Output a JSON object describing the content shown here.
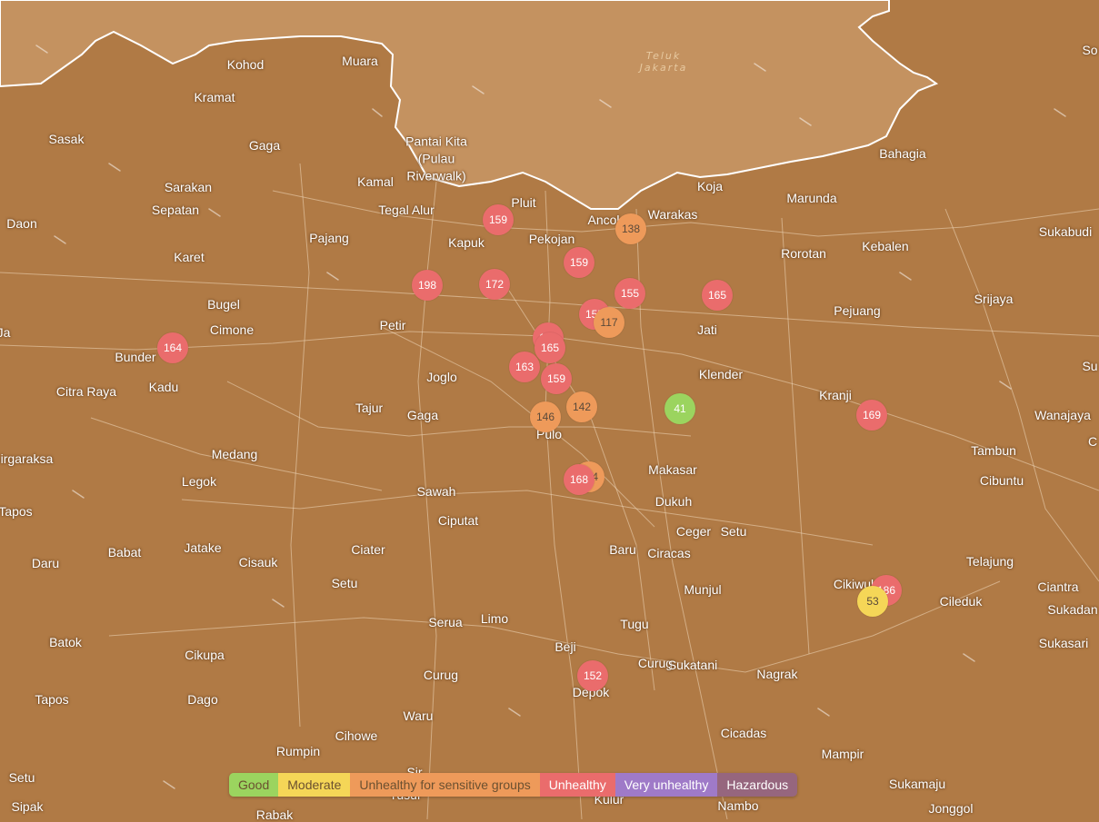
{
  "colors": {
    "land": "#b07a45",
    "water": "#c49260",
    "coast": "#ffffff",
    "good": "#9bd45f",
    "moderate": "#f5d657",
    "sensitive": "#ee9a5a",
    "unhealthy": "#ea6c6c",
    "very_unhealthy": "#9f7ac8",
    "hazardous": "#96667e"
  },
  "water_label": "Teluk\nJakarta",
  "places": [
    "Kohod",
    "Muara",
    "Kramat",
    "Sasak",
    "Gaga",
    "Pantai Kita\n(Pulau\nRiverwalk)",
    "Sarakan",
    "Sepatan",
    "Kamal",
    "Tegal Alur",
    "Pluit",
    "Daon",
    "Pajang",
    "Kapuk",
    "Pekojan",
    "Ancol",
    "Warakas",
    "Koja",
    "Marunda",
    "Bahagia",
    "Sukabudi",
    "Kebalen",
    "Rorotan",
    "Karet",
    "Bugel",
    "Cimone",
    "Petir",
    "Jati",
    "Pejuang",
    "Srijaya",
    "Bunder",
    "Citra Raya",
    "Kadu",
    "Joglo",
    "Klender",
    "Kranji",
    "Tajur",
    "Gaga",
    "Pulo",
    "Wanajaya",
    "Tambun",
    "Cibuntu",
    "Medang",
    "Legok",
    "Sawah",
    "Makasar",
    "Dukuh",
    "Ciputat",
    "Ceger",
    "Setu",
    "Babat",
    "Jatake",
    "Tapos",
    "Daru",
    "Cisauk",
    "Ciater",
    "Baru",
    "Ciracas",
    "Setu",
    "Telajung",
    "Ciantra",
    "Sukadan",
    "Munjul",
    "Cikiwul",
    "Cileduk",
    "Serua",
    "Limo",
    "Tugu",
    "Sukasari",
    "Batok",
    "Cikupa",
    "Beji",
    "Curug",
    "Curug",
    "Sukatani",
    "Nagrak",
    "Tapos",
    "Dago",
    "Depok",
    "Waru",
    "Cihowe",
    "Cicadas",
    "Rumpin",
    "Mampir",
    "Setu",
    "Sukamaju",
    "Sipak",
    "Nambo",
    "Jonggol",
    "Rabak",
    "Sir",
    "Tusur",
    "Kulur",
    "Girgaraksa",
    "Ja",
    "So",
    "Su",
    "C"
  ],
  "stations": [
    {
      "value": "159",
      "level": "unhealthy"
    },
    {
      "value": "138",
      "level": "sensitive"
    },
    {
      "value": "159",
      "level": "unhealthy"
    },
    {
      "value": "198",
      "level": "unhealthy"
    },
    {
      "value": "172",
      "level": "unhealthy"
    },
    {
      "value": "155",
      "level": "unhealthy"
    },
    {
      "value": "165",
      "level": "unhealthy"
    },
    {
      "value": "155",
      "level": "unhealthy"
    },
    {
      "value": "117",
      "level": "sensitive"
    },
    {
      "value": "164",
      "level": "unhealthy"
    },
    {
      "value": "162",
      "level": "unhealthy"
    },
    {
      "value": "165",
      "level": "unhealthy"
    },
    {
      "value": "163",
      "level": "unhealthy"
    },
    {
      "value": "159",
      "level": "unhealthy"
    },
    {
      "value": "142",
      "level": "sensitive"
    },
    {
      "value": "146",
      "level": "sensitive"
    },
    {
      "value": "41",
      "level": "good"
    },
    {
      "value": "169",
      "level": "unhealthy"
    },
    {
      "value": "144",
      "level": "sensitive"
    },
    {
      "value": "168",
      "level": "unhealthy"
    },
    {
      "value": "186",
      "level": "unhealthy"
    },
    {
      "value": "53",
      "level": "moderate"
    },
    {
      "value": "152",
      "level": "unhealthy"
    }
  ],
  "legend": [
    {
      "label": "Good",
      "level": "good"
    },
    {
      "label": "Moderate",
      "level": "moderate"
    },
    {
      "label": "Unhealthy for sensitive groups",
      "level": "sensitive"
    },
    {
      "label": "Unhealthy",
      "level": "unhealthy"
    },
    {
      "label": "Very unhealthy",
      "level": "very_unhealthy"
    },
    {
      "label": "Hazardous",
      "level": "hazardous"
    }
  ]
}
